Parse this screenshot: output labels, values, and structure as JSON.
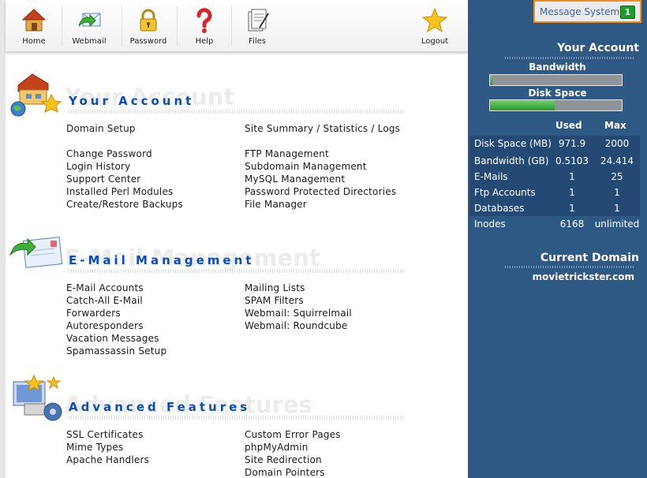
{
  "toolbar": {
    "home": "Home",
    "webmail": "Webmail",
    "password": "Password",
    "help": "Help",
    "files": "Files",
    "logout": "Logout"
  },
  "sections": {
    "account": {
      "title": "Your Account",
      "ghost": "Your Account",
      "left": [
        "Domain Setup",
        "Change Password",
        "Login History",
        "Support Center",
        "Installed Perl Modules",
        "Create/Restore Backups"
      ],
      "right": [
        "Site Summary / Statistics / Logs",
        "FTP Management",
        "Subdomain Management",
        "MySQL Management",
        "Password Protected Directories",
        "File Manager"
      ]
    },
    "email": {
      "title": "E-Mail Management",
      "ghost": "E-Mail Management",
      "left": [
        "E-Mail Accounts",
        "Catch-All E-Mail",
        "Forwarders",
        "Autoresponders",
        "Vacation Messages",
        "Spamassassin Setup"
      ],
      "right": [
        "Mailing Lists",
        "SPAM Filters",
        "Webmail: Squirrelmail",
        "Webmail: Roundcube"
      ]
    },
    "advanced": {
      "title": "Advanced Features",
      "ghost": "Advanced Features",
      "left": [
        "SSL Certificates",
        "Mime Types",
        "Apache Handlers"
      ],
      "right": [
        "Custom Error Pages",
        "phpMyAdmin",
        "Site Redirection",
        "Domain Pointers"
      ]
    }
  },
  "panel": {
    "message_system": "Message System",
    "message_count": "1",
    "your_account": "Your Account",
    "bandwidth_label": "Bandwidth",
    "bandwidth_fraction": 0.02,
    "disk_label": "Disk Space",
    "disk_fraction": 0.49,
    "col_used": "Used",
    "col_max": "Max",
    "stats": [
      {
        "label": "Disk Space (MB)",
        "used": "971.9",
        "max": "2000"
      },
      {
        "label": "Bandwidth (GB)",
        "used": "0.5103",
        "max": "24.414"
      },
      {
        "label": "E-Mails",
        "used": "1",
        "max": "25"
      },
      {
        "label": "Ftp Accounts",
        "used": "1",
        "max": "1"
      },
      {
        "label": "Databases",
        "used": "1",
        "max": "1"
      },
      {
        "label": "Inodes",
        "used": "6168",
        "max": "unlimited"
      }
    ],
    "current_domain_label": "Current Domain",
    "current_domain": "movietrickster.com"
  },
  "colors": {
    "panel_bg": "#2f5985",
    "section_title": "#0b4db8",
    "highlight": "#f28c1a",
    "badge": "#1f9a2c"
  }
}
